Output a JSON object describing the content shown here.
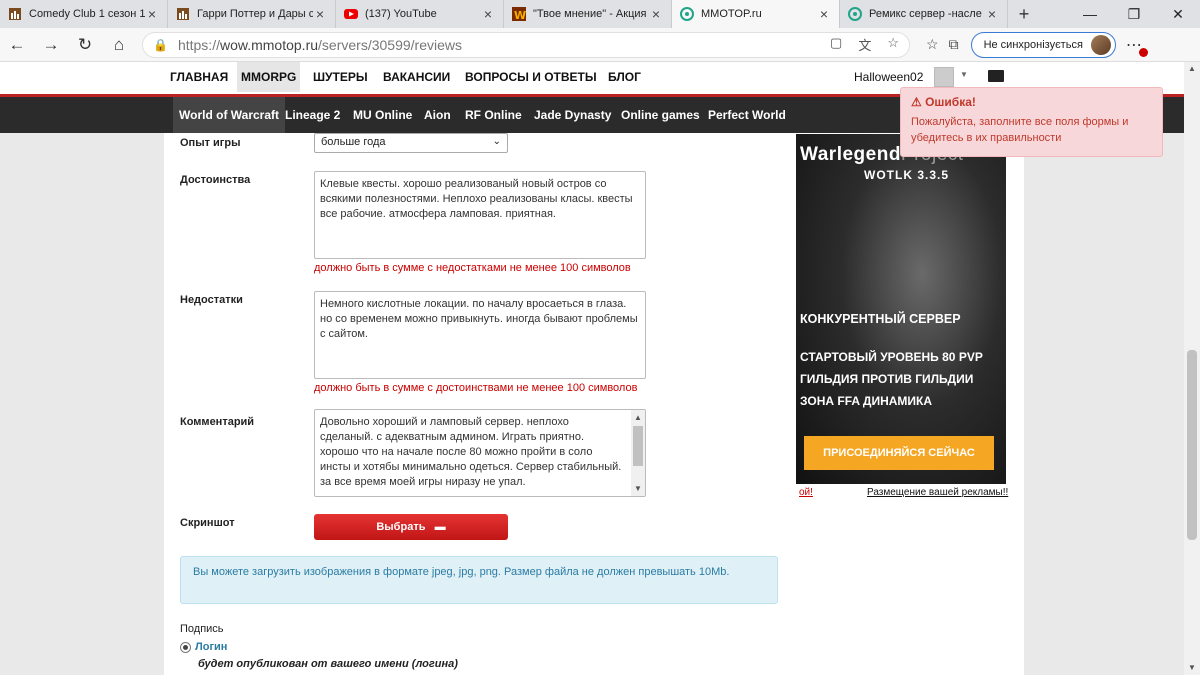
{
  "browser": {
    "tabs": [
      {
        "title": "Comedy Club 1 сезон 1",
        "active": false
      },
      {
        "title": "Гарри Поттер и Дары с",
        "active": false
      },
      {
        "title": "(137) YouTube",
        "active": false
      },
      {
        "title": "\"Твое мнение\" - Акция",
        "active": false
      },
      {
        "title": "MMOTOP.ru",
        "active": true
      },
      {
        "title": "Ремикс сервер -насле",
        "active": false
      }
    ],
    "url_prefix": "https://",
    "url_host": "wow.mmotop.ru",
    "url_path": "/servers/30599/reviews",
    "sync_label": "Не синхронізується"
  },
  "site": {
    "nav": [
      "ГЛАВНАЯ",
      "MMORPG",
      "ШУТЕРЫ",
      "ВАКАНСИИ",
      "ВОПРОСЫ И ОТВЕТЫ",
      "БЛОГ"
    ],
    "username": "Halloween02",
    "games": [
      "World of Warcraft",
      "Lineage 2",
      "MU Online",
      "Aion",
      "RF Online",
      "Jade Dynasty",
      "Online games",
      "Perfect World"
    ]
  },
  "form": {
    "experience_label": "Опыт игры",
    "experience_value": "больше года",
    "pros_label": "Достоинства",
    "pros_text": "Клевые квесты. хорошо реализованый новый остров со всякими полезностями. Неплохо реализованы класы. квесты все рабочие. атмосфера ламповая. приятная.",
    "pros_error": "должно быть в сумме с недостатками не менее 100 символов",
    "cons_label": "Недостатки",
    "cons_text": "Немного кислотные локации. по началу вросаеться в глаза. но со временем можно привыкнуть. иногда бывают проблемы с сайтом.",
    "cons_error": "должно быть в сумме с достоинствами не менее 100 символов",
    "comment_label": "Комментарий",
    "comment_text": "Довольно хороший и ламповый сервер. неплохо сделаный. с адекватным админом. Играть приятно. хорошо что на начале после 80 можно пройти в соло инсты и хотябы минимально одеться. Сервер стабильный. за все время моей игры ниразу не упал.",
    "screenshot_label": "Скриншот",
    "choose_button": "Выбрать",
    "upload_info": "Вы можете загрузить изображения в формате jpeg, jpg, png. Размер файла не должен превышать 10Mb.",
    "signature_label": "Подпись",
    "login_option": "Логин",
    "login_note": "будет опубликован от вашего имени (логина)"
  },
  "ad": {
    "brand_main": "Warlegend",
    "brand_rest": "Project",
    "subtitle": "WOTLK 3.3.5",
    "line1": "КОНКУРЕНТНЫЙ СЕРВЕР",
    "line2": "СТАРТОВЫЙ УРОВЕНЬ 80 PVP",
    "line3": "ГИЛЬДИЯ ПРОТИВ ГИЛЬДИИ",
    "line4": "ЗОНА FFA ДИНАМИКА",
    "cta": "ПРИСОЕДИНЯЙСЯ СЕЙЧАС",
    "link_left": "ой!",
    "link_right": "Размещение вашей рекламы!!"
  },
  "toast": {
    "title": "Ошибка!",
    "message": "Пожалуйста, заполните все поля формы и убедитесь в их правильности"
  },
  "colors": {
    "accent_red": "#c11616",
    "info_bg": "#dff0f7",
    "toast_bg": "#f8d7da"
  }
}
